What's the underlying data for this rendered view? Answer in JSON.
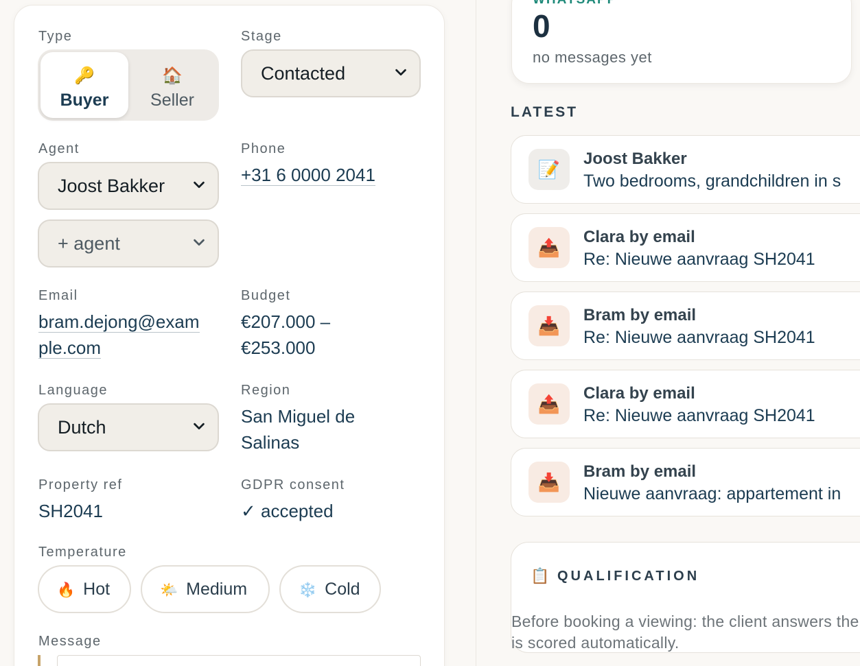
{
  "form": {
    "type": {
      "label": "Type",
      "options": [
        {
          "emoji": "🔑",
          "label": "Buyer"
        },
        {
          "emoji": "🏠",
          "label": "Seller"
        }
      ],
      "selected": "Buyer"
    },
    "stage": {
      "label": "Stage",
      "value": "Contacted"
    },
    "agent": {
      "label": "Agent",
      "value": "Joost Bakker",
      "add_label": "+ agent"
    },
    "phone": {
      "label": "Phone",
      "value": "+31 6 0000 2041"
    },
    "email": {
      "label": "Email",
      "value_line1": "bram.dejong@exam",
      "value_line2": "ple.com"
    },
    "budget": {
      "label": "Budget",
      "value_line1": "€207.000 –",
      "value_line2": "€253.000"
    },
    "language": {
      "label": "Language",
      "value": "Dutch"
    },
    "region": {
      "label": "Region",
      "value_line1": "San Miguel de",
      "value_line2": "Salinas"
    },
    "property_ref": {
      "label": "Property ref",
      "value": "SH2041"
    },
    "gdpr": {
      "label": "GDPR consent",
      "value": "✓ accepted"
    },
    "temperature": {
      "label": "Temperature",
      "options": [
        {
          "emoji": "🔥",
          "label": "Hot"
        },
        {
          "emoji": "🌤️",
          "label": "Medium"
        },
        {
          "emoji": "❄️",
          "label": "Cold"
        }
      ]
    },
    "message": {
      "label": "Message"
    }
  },
  "whatsapp": {
    "title": "WHATSAPP",
    "count": "0",
    "subtitle": "no messages yet"
  },
  "latest": {
    "heading": "LATEST",
    "items": [
      {
        "icon": "memo-icon",
        "emoji": "📝",
        "title": "Joost Bakker",
        "subtitle": "Two bedrooms, grandchildren in s"
      },
      {
        "icon": "outbox-icon",
        "emoji": "📤",
        "title": "Clara by email",
        "subtitle": "Re: Nieuwe aanvraag SH2041"
      },
      {
        "icon": "inbox-icon",
        "emoji": "📥",
        "title": "Bram by email",
        "subtitle": "Re: Nieuwe aanvraag SH2041"
      },
      {
        "icon": "outbox-icon",
        "emoji": "📤",
        "title": "Clara by email",
        "subtitle": "Re: Nieuwe aanvraag SH2041"
      },
      {
        "icon": "inbox-icon",
        "emoji": "📥",
        "title": "Bram by email",
        "subtitle": "Nieuwe aanvraag: appartement in"
      }
    ]
  },
  "qualification": {
    "icon": "clipboard-icon",
    "emoji": "📋",
    "title": "QUALIFICATION",
    "text": "Before booking a viewing: the client answers the lead is scored automatically."
  }
}
